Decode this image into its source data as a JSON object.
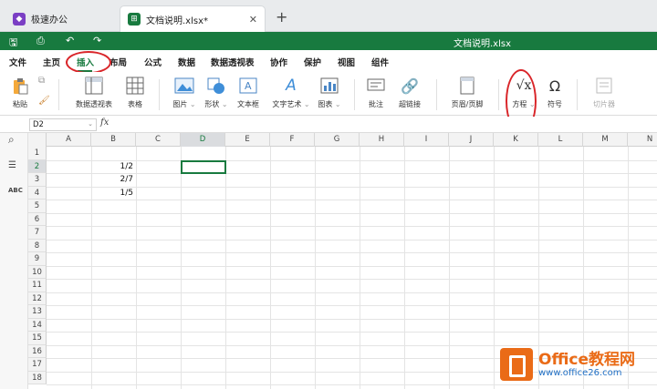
{
  "tabs": [
    {
      "label": "极速办公",
      "icon": "app-logo-icon"
    },
    {
      "label": "文档说明.xlsx*",
      "icon": "spreadsheet-icon"
    }
  ],
  "doc_title": "文档说明.xlsx",
  "menu": [
    "文件",
    "主页",
    "插入",
    "布局",
    "公式",
    "数据",
    "数据透视表",
    "协作",
    "保护",
    "视图",
    "组件"
  ],
  "active_menu": "插入",
  "ribbon": {
    "paste": "粘贴",
    "pivot": "数据透视表",
    "table": "表格",
    "picture": "图片",
    "shape": "形状",
    "textbox": "文本框",
    "wordart": "文字艺术",
    "chart": "图表",
    "comment": "批注",
    "hyperlink": "超链接",
    "header_footer": "页眉/页脚",
    "equation": "方程",
    "symbol": "符号",
    "slicer": "切片器"
  },
  "name_box": "D2",
  "fx_label": "fx",
  "columns": [
    "A",
    "B",
    "C",
    "D",
    "E",
    "F",
    "G",
    "H",
    "I",
    "J",
    "K",
    "L",
    "M",
    "N"
  ],
  "rows": [
    "1",
    "2",
    "3",
    "4",
    "5",
    "6",
    "7",
    "8",
    "9",
    "10",
    "11",
    "12",
    "13",
    "14",
    "15",
    "16",
    "17",
    "18"
  ],
  "selected_cell": "D2",
  "cells": [
    {
      "ref": "B2",
      "value": "1/2"
    },
    {
      "ref": "B3",
      "value": "2/7"
    },
    {
      "ref": "B4",
      "value": "1/5"
    }
  ],
  "watermark": {
    "brand": "Office教程网",
    "url": "www.office26.com"
  },
  "colors": {
    "accent": "#187a3f",
    "annotation": "#d9262a",
    "watermark_orange": "#ea6b17"
  }
}
